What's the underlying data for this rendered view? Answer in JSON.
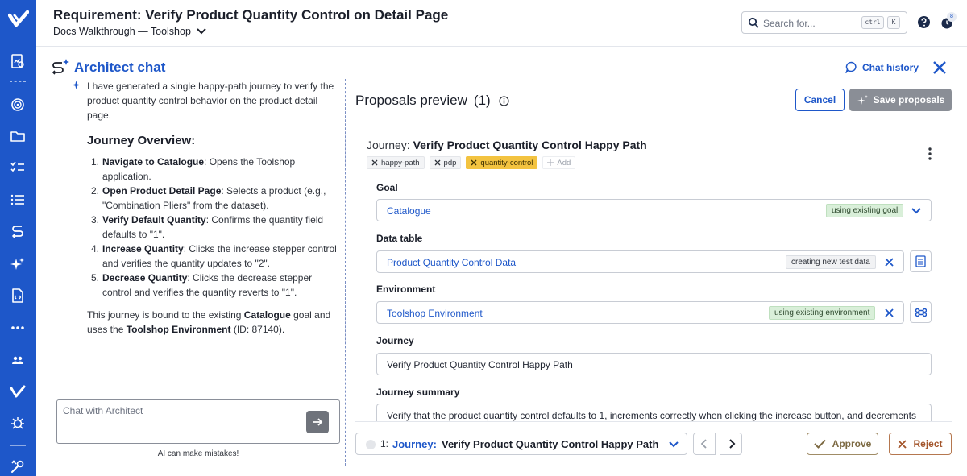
{
  "header": {
    "title": "Requirement: Verify Product Quantity Control on Detail Page",
    "breadcrumb": "Docs Walkthrough — Toolshop",
    "search_placeholder": "Search for...",
    "shortcut_ctrl": "ctrl",
    "shortcut_key": "K",
    "notification_count": "8"
  },
  "rail": {
    "icons": [
      "logo-check-icon",
      "report-icon",
      "target-icon",
      "folder-icon",
      "checklist-icon",
      "list-icon",
      "flow-icon",
      "sparkle-icon",
      "file-code-icon",
      "more-icon",
      "people-icon",
      "brand-icon",
      "bug-icon",
      "tools-icon"
    ],
    "bg": "#1e57c9"
  },
  "chat": {
    "title": "Architect chat",
    "intro": "I have generated a single happy-path journey to verify the product quantity control behavior on the product detail page.",
    "overview_heading": "Journey Overview:",
    "steps": [
      {
        "num": "1.",
        "bold": "Navigate to Catalogue",
        "text": ": Opens the Toolshop application."
      },
      {
        "num": "2.",
        "bold": "Open Product Detail Page",
        "text": ": Selects a product (e.g., \"Combination Pliers\" from the dataset)."
      },
      {
        "num": "3.",
        "bold": "Verify Default Quantity",
        "text": ": Confirms the quantity field defaults to \"1\"."
      },
      {
        "num": "4.",
        "bold": "Increase Quantity",
        "text": ": Clicks the increase stepper control and verifies the quantity updates to \"2\"."
      },
      {
        "num": "5.",
        "bold": "Decrease Quantity",
        "text": ": Clicks the decrease stepper control and verifies the quantity reverts to \"1\"."
      }
    ],
    "outro_1": "This journey is bound to the existing ",
    "outro_bold_1": "Catalogue",
    "outro_2": " goal and uses the ",
    "outro_bold_2": "Toolshop Environment",
    "outro_3": " (ID: 87140).",
    "input_placeholder": "Chat with Architect",
    "disclaimer": "AI can make mistakes!"
  },
  "history": {
    "label": "Chat history"
  },
  "proposals": {
    "title": "Proposals preview",
    "count": "(1)",
    "cancel_label": "Cancel",
    "save_label": "Save proposals",
    "journey_prefix": "Journey:",
    "journey_name": "Verify Product Quantity Control Happy Path",
    "tags": [
      {
        "label": "happy-path",
        "warn": false
      },
      {
        "label": "pdp",
        "warn": false
      },
      {
        "label": "quantity-control",
        "warn": true
      }
    ],
    "add_tag_label": "Add",
    "goal": {
      "label": "Goal",
      "value": "Catalogue",
      "badge": "using existing goal"
    },
    "data_table": {
      "label": "Data table",
      "value": "Product Quantity Control Data",
      "badge": "creating new test data"
    },
    "environment": {
      "label": "Environment",
      "value": "Toolshop Environment",
      "badge": "using existing environment"
    },
    "journey": {
      "label": "Journey",
      "value": "Verify Product Quantity Control Happy Path"
    },
    "summary": {
      "label": "Journey summary",
      "value": "Verify that the product quantity control defaults to 1, increments correctly when clicking the increase button, and decrements"
    }
  },
  "footer": {
    "num": "1:",
    "label": "Journey:",
    "name": "Verify Product Quantity Control Happy Path",
    "approve_label": "Approve",
    "reject_label": "Reject"
  },
  "colors": {
    "brand": "#1e57c9",
    "badge_green": "#d9efd9",
    "tag_warn": "#f3c340"
  }
}
